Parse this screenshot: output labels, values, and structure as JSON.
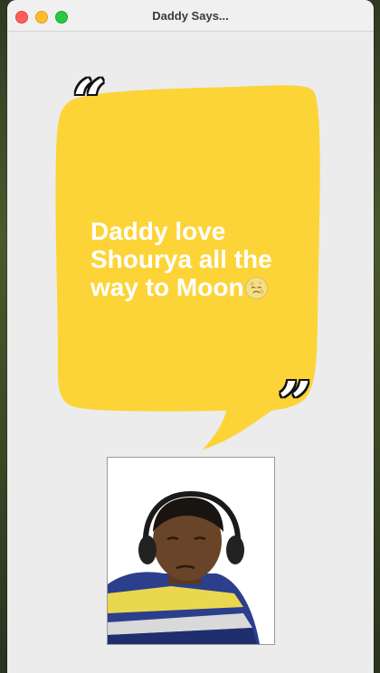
{
  "window": {
    "title": "Daddy Says..."
  },
  "quote": {
    "text": "Daddy love Shourya all the way to Moon",
    "emoji": "moon-face-emoji",
    "bubble_color": "#fdd438",
    "text_color": "#ffffff"
  },
  "photo": {
    "description": "person-photo"
  },
  "colors": {
    "close": "#ff5f57",
    "minimize": "#febc2e",
    "maximize": "#28c840",
    "window_bg": "#ececec"
  }
}
